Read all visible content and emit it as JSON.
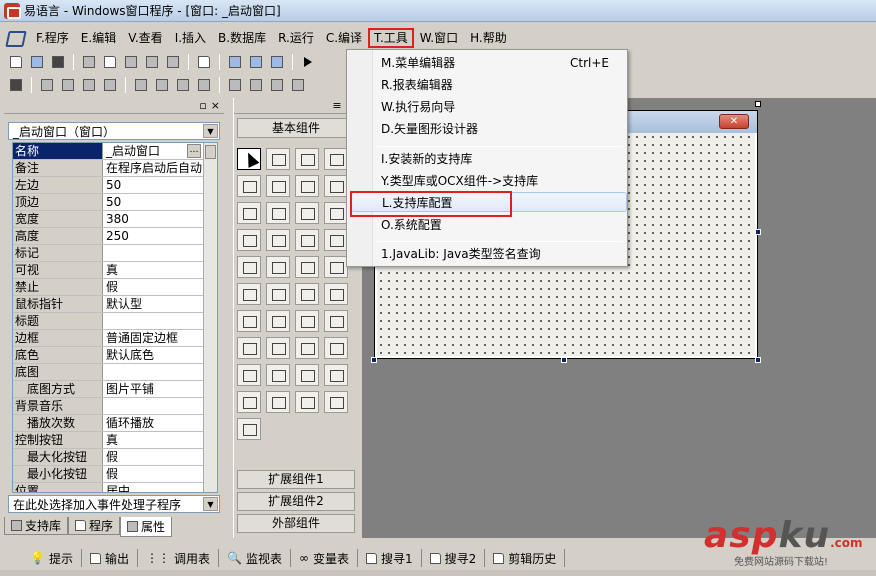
{
  "window": {
    "title": "易语言 - Windows窗口程序 - [窗口: _启动窗口]"
  },
  "menubar": {
    "items": [
      {
        "label": "F.程序"
      },
      {
        "label": "E.编辑"
      },
      {
        "label": "V.查看"
      },
      {
        "label": "I.插入"
      },
      {
        "label": "B.数据库"
      },
      {
        "label": "R.运行"
      },
      {
        "label": "C.编译"
      },
      {
        "label": "T.工具"
      },
      {
        "label": "W.窗口"
      },
      {
        "label": "H.帮助"
      }
    ]
  },
  "tools_menu": {
    "items": [
      {
        "label": "M.菜单编辑器",
        "shortcut": "Ctrl+E"
      },
      {
        "label": "R.报表编辑器"
      },
      {
        "label": "W.执行易向导"
      },
      {
        "label": "D.矢量图形设计器"
      },
      {
        "label": "I.安装新的支持库"
      },
      {
        "label": "Y.类型库或OCX组件->支持库"
      },
      {
        "label": "L.支持库配置"
      },
      {
        "label": "O.系统配置"
      },
      {
        "label": "1.JavaLib: Java类型签名查询"
      }
    ]
  },
  "property_panel": {
    "object_selector": "_启动窗口（窗口）",
    "properties": [
      {
        "name": "名称",
        "value": "_启动窗口"
      },
      {
        "name": "备注",
        "value": "在程序启动后自动"
      },
      {
        "name": "左边",
        "value": "50"
      },
      {
        "name": "顶边",
        "value": "50"
      },
      {
        "name": "宽度",
        "value": "380"
      },
      {
        "name": "高度",
        "value": "250"
      },
      {
        "name": "标记",
        "value": ""
      },
      {
        "name": "可视",
        "value": "真"
      },
      {
        "name": "禁止",
        "value": "假"
      },
      {
        "name": "鼠标指针",
        "value": "默认型"
      },
      {
        "name": "标题",
        "value": ""
      },
      {
        "name": "边框",
        "value": "普通固定边框"
      },
      {
        "name": "底色",
        "value": "默认底色"
      },
      {
        "name": "底图",
        "value": ""
      },
      {
        "name": "底图方式",
        "value": "图片平铺"
      },
      {
        "name": "背景音乐",
        "value": ""
      },
      {
        "name": "播放次数",
        "value": "循环播放"
      },
      {
        "name": "控制按钮",
        "value": "真"
      },
      {
        "name": "最大化按钮",
        "value": "假"
      },
      {
        "name": "最小化按钮",
        "value": "假"
      },
      {
        "name": "位置",
        "value": "居中"
      }
    ],
    "event_selector": "在此处选择加入事件处理子程序",
    "tabs": [
      {
        "label": "支持库"
      },
      {
        "label": "程序"
      },
      {
        "label": "属性"
      }
    ]
  },
  "component_panel": {
    "title": "基本组件",
    "ext1": "扩展组件1",
    "ext2": "扩展组件2",
    "external": "外部组件"
  },
  "output_tabs": [
    {
      "label": "提示"
    },
    {
      "label": "输出"
    },
    {
      "label": "调用表"
    },
    {
      "label": "监视表"
    },
    {
      "label": "变量表"
    },
    {
      "label": "搜寻1"
    },
    {
      "label": "搜寻2"
    },
    {
      "label": "剪辑历史"
    }
  ],
  "watermark": {
    "main_a": "asp",
    "main_b": "ku",
    "suffix": ".com",
    "sub": "免费网站源码下载站!"
  },
  "colors": {
    "highlight_box": "#e02020",
    "selection": "#0a246a"
  }
}
